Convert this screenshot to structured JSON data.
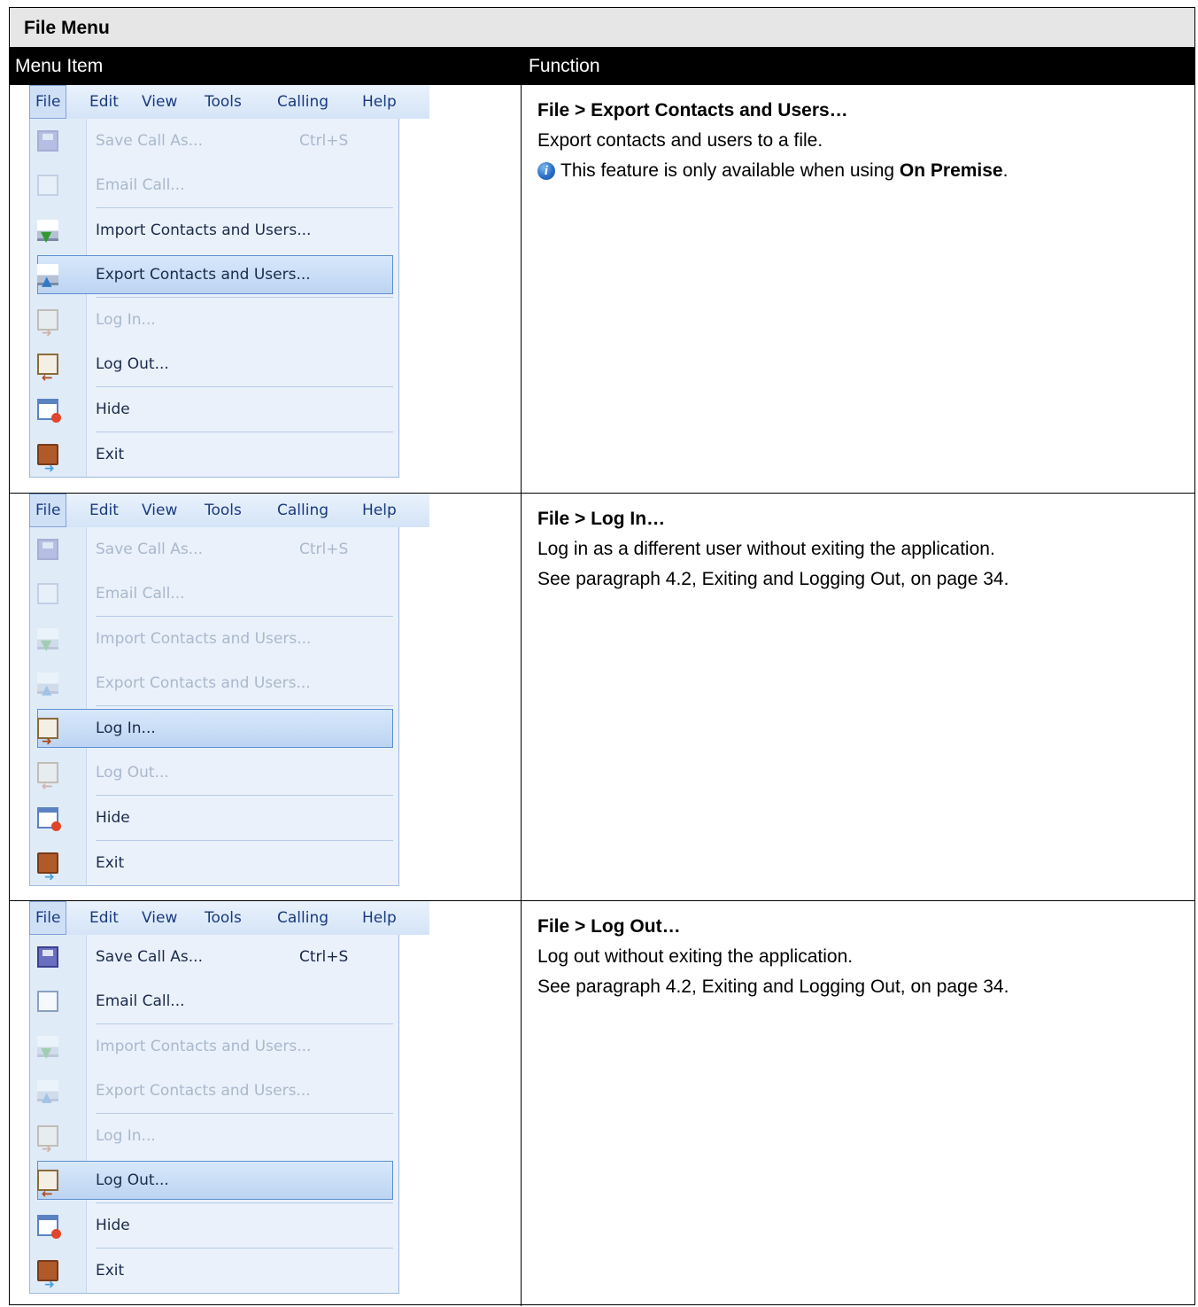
{
  "table": {
    "title": "File Menu",
    "col_menu_item": "Menu Item",
    "col_function": "Function"
  },
  "menubar": {
    "file": "File",
    "edit": "Edit",
    "view": "View",
    "tools": "Tools",
    "calling": "Calling",
    "help": "Help"
  },
  "menu_labels": {
    "save_call_as": "Save Call As...",
    "save_shortcut": "Ctrl+S",
    "email_call": "Email Call...",
    "import": "Import Contacts and Users...",
    "export": "Export Contacts and Users...",
    "log_in": "Log In...",
    "log_out": "Log Out...",
    "hide": "Hide",
    "exit": "Exit"
  },
  "rows": [
    {
      "title": "File > Export Contacts and Users…",
      "desc": "Export contacts and users to a file.",
      "note_prefix": "This feature is only available when using ",
      "note_bold": "On Premise",
      "note_suffix": "."
    },
    {
      "title": "File > Log In…",
      "desc": "Log in as a different user without exiting the application.",
      "ref": "See paragraph 4.2, Exiting and Logging Out, on page 34."
    },
    {
      "title": "File > Log Out…",
      "desc": "Log out without exiting the application.",
      "ref": "See paragraph 4.2, Exiting and Logging Out, on page 34."
    }
  ],
  "icons": {
    "info": "info-icon",
    "save": "floppy-disk-icon",
    "email": "envelope-icon",
    "import": "import-icon",
    "export": "export-icon",
    "log_in": "log-in-icon",
    "log_out": "log-out-icon",
    "hide": "hide-window-icon",
    "exit": "exit-door-icon"
  }
}
